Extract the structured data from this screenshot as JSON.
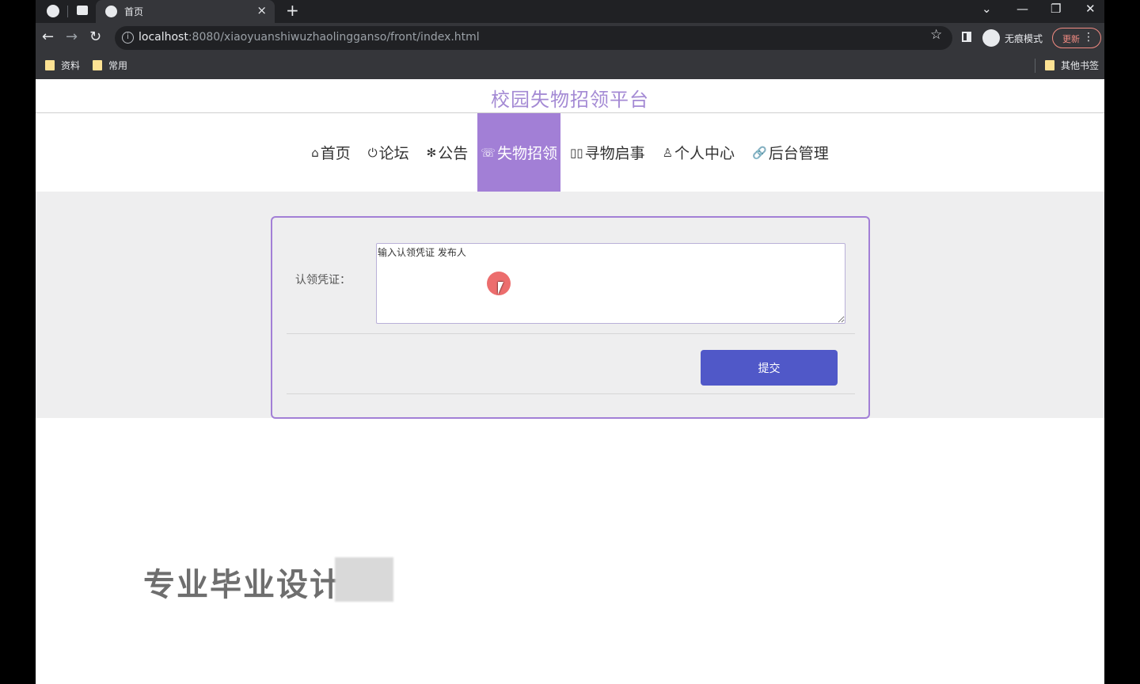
{
  "browser": {
    "tab_title": "首页",
    "tab_close": "×",
    "new_tab": "+",
    "url_host": "localhost",
    "url_path": ":8080/xiaoyuanshiwuzhaolingganso/front/index.html",
    "incognito_label": "无痕模式",
    "update_label": "更新",
    "bookmarks": [
      "资料",
      "常用"
    ],
    "other_bookmarks": "其他书签",
    "window_controls": [
      "⌄",
      "—",
      "❐",
      "✕"
    ]
  },
  "site": {
    "title": "校园失物招领平台",
    "nav": [
      {
        "icon": "⌂",
        "label": "首页"
      },
      {
        "icon": "⏻",
        "label": "论坛"
      },
      {
        "icon": "✻",
        "label": "公告"
      },
      {
        "icon": "☏",
        "label": "失物招领"
      },
      {
        "icon": "▯▯",
        "label": "寻物启事"
      },
      {
        "icon": "♙",
        "label": "个人中心"
      },
      {
        "icon": "🔗",
        "label": "后台管理"
      }
    ],
    "active_nav": "失物招领"
  },
  "form": {
    "field_label": "认领凭证：",
    "field_value": "输入认领凭证 发布人",
    "submit_label": "提交"
  },
  "watermark": "专业毕业设计"
}
